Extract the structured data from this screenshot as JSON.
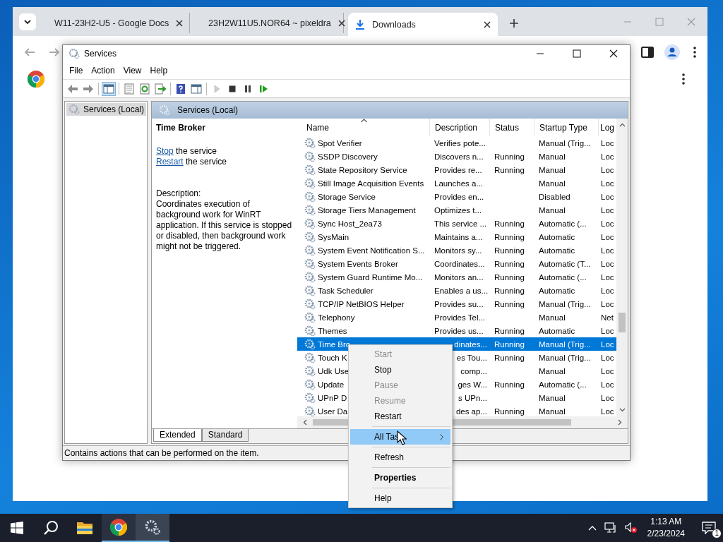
{
  "browser": {
    "tabs": [
      {
        "kind": "docs",
        "title": "W11-23H2-U5 - Google Docs",
        "selected": false
      },
      {
        "kind": "pixeldrain",
        "title": "23H2W11U5.NOR64 ~ pixeldra",
        "selected": false
      },
      {
        "kind": "download",
        "title": "Downloads",
        "selected": true
      }
    ]
  },
  "services_window": {
    "title": "Services",
    "menu": [
      "File",
      "Action",
      "View",
      "Help"
    ],
    "toolbar": [
      [
        {
          "kind": "back",
          "pressed": false,
          "disabled": false
        },
        {
          "kind": "forward",
          "pressed": false,
          "disabled": false
        }
      ],
      [
        {
          "kind": "tree",
          "pressed": true,
          "disabled": false
        }
      ],
      [
        {
          "kind": "sheet",
          "pressed": false,
          "disabled": false
        },
        {
          "kind": "refresh",
          "pressed": false,
          "disabled": false
        },
        {
          "kind": "export",
          "pressed": false,
          "disabled": false
        }
      ],
      [
        {
          "kind": "help",
          "pressed": false,
          "disabled": false
        },
        {
          "kind": "view",
          "pressed": false,
          "disabled": false
        }
      ],
      [
        {
          "kind": "play",
          "pressed": false,
          "disabled": true
        },
        {
          "kind": "stop",
          "pressed": false,
          "disabled": false
        },
        {
          "kind": "pause",
          "pressed": false,
          "disabled": false
        },
        {
          "kind": "restart",
          "pressed": false,
          "disabled": false
        }
      ]
    ],
    "tree": [
      {
        "label": "Services (Local)",
        "selected": true
      }
    ],
    "pane_title": "Services (Local)",
    "detail": {
      "name": "Time Broker",
      "actions": [
        {
          "link": "Stop",
          "text": "the service"
        },
        {
          "link": "Restart",
          "text": "the service"
        }
      ],
      "description_label": "Description:",
      "description": "Coordinates execution of background work for WinRT application. If this service is stopped or disabled, then background work might not be triggered."
    },
    "table": {
      "columns": [
        {
          "label": "Name",
          "sorted": true
        },
        {
          "label": "Description",
          "sorted": false
        },
        {
          "label": "Status",
          "sorted": false
        },
        {
          "label": "Startup Type",
          "sorted": false
        },
        {
          "label": "Log",
          "sorted": false
        }
      ],
      "rows": [
        {
          "name": "Spot Verifier",
          "description": "Verifies pote...",
          "startup": "Manual (Trig...",
          "log": "Loc",
          "selected": false,
          "covered": false
        },
        {
          "name": "SSDP Discovery",
          "description": "Discovers n...",
          "status": "Running",
          "startup": "Manual",
          "log": "Loc",
          "selected": false,
          "covered": false
        },
        {
          "name": "State Repository Service",
          "description": "Provides re...",
          "status": "Running",
          "startup": "Manual",
          "log": "Loc",
          "selected": false,
          "covered": false
        },
        {
          "name": "Still Image Acquisition Events",
          "description": "Launches a...",
          "startup": "Manual",
          "log": "Loc",
          "selected": false,
          "covered": false
        },
        {
          "name": "Storage Service",
          "description": "Provides en...",
          "startup": "Disabled",
          "log": "Loc",
          "selected": false,
          "covered": false
        },
        {
          "name": "Storage Tiers Management",
          "description": "Optimizes t...",
          "startup": "Manual",
          "log": "Loc",
          "selected": false,
          "covered": false
        },
        {
          "name": "Sync Host_2ea73",
          "description": "This service ...",
          "status": "Running",
          "startup": "Automatic (...",
          "log": "Loc",
          "selected": false,
          "covered": false
        },
        {
          "name": "SysMain",
          "description": "Maintains a...",
          "status": "Running",
          "startup": "Automatic",
          "log": "Loc",
          "selected": false,
          "covered": false
        },
        {
          "name": "System Event Notification S...",
          "description": "Monitors sy...",
          "status": "Running",
          "startup": "Automatic",
          "log": "Loc",
          "selected": false,
          "covered": false
        },
        {
          "name": "System Events Broker",
          "description": "Coordinates...",
          "status": "Running",
          "startup": "Automatic (T...",
          "log": "Loc",
          "selected": false,
          "covered": false
        },
        {
          "name": "System Guard Runtime Mo...",
          "description": "Monitors an...",
          "status": "Running",
          "startup": "Automatic (...",
          "log": "Loc",
          "selected": false,
          "covered": false
        },
        {
          "name": "Task Scheduler",
          "description": "Enables a us...",
          "status": "Running",
          "startup": "Automatic",
          "log": "Loc",
          "selected": false,
          "covered": false
        },
        {
          "name": "TCP/IP NetBIOS Helper",
          "description": "Provides su...",
          "status": "Running",
          "startup": "Manual (Trig...",
          "log": "Loc",
          "selected": false,
          "covered": false
        },
        {
          "name": "Telephony",
          "description": "Provides Tel...",
          "startup": "Manual",
          "log": "Net",
          "selected": false,
          "covered": false
        },
        {
          "name": "Themes",
          "description": "Provides us...",
          "status": "Running",
          "startup": "Automatic",
          "log": "Loc",
          "selected": false,
          "covered": false
        },
        {
          "name": "Time Bro",
          "description": "dinates...",
          "status": "Running",
          "startup": "Manual (Trig...",
          "log": "Loc",
          "selected": true,
          "covered": true
        },
        {
          "name": "Touch K",
          "description": "es Tou...",
          "status": "Running",
          "startup": "Manual (Trig...",
          "log": "Loc",
          "selected": false,
          "covered": true
        },
        {
          "name": "Udk Use",
          "description": "comp...",
          "startup": "Manual",
          "log": "Loc",
          "selected": false,
          "covered": true
        },
        {
          "name": "Update",
          "description": "ges W...",
          "status": "Running",
          "startup": "Automatic (...",
          "log": "Loc",
          "selected": false,
          "covered": true
        },
        {
          "name": "UPnP D",
          "description": "s UPn...",
          "startup": "Manual",
          "log": "Loc",
          "selected": false,
          "covered": true
        },
        {
          "name": "User Da",
          "description": "des ap...",
          "status": "Running",
          "startup": "Manual",
          "log": "Loc",
          "selected": false,
          "covered": true
        }
      ]
    },
    "view_tabs": [
      {
        "label": "Extended",
        "selected": true
      },
      {
        "label": "Standard",
        "selected": false
      }
    ],
    "status_bar": "Contains actions that can be performed on the item."
  },
  "context_menu": {
    "groups": [
      [
        {
          "label": "Start",
          "disabled": true,
          "selected": false,
          "default": false,
          "submenu": false
        },
        {
          "label": "Stop",
          "disabled": false,
          "selected": false,
          "default": false,
          "submenu": false
        },
        {
          "label": "Pause",
          "disabled": true,
          "selected": false,
          "default": false,
          "submenu": false
        },
        {
          "label": "Resume",
          "disabled": true,
          "selected": false,
          "default": false,
          "submenu": false
        },
        {
          "label": "Restart",
          "disabled": false,
          "selected": false,
          "default": false,
          "submenu": false
        }
      ],
      [
        {
          "label": "All Tas",
          "disabled": false,
          "selected": true,
          "default": false,
          "submenu": true
        }
      ],
      [
        {
          "label": "Refresh",
          "disabled": false,
          "selected": false,
          "default": false,
          "submenu": false
        }
      ],
      [
        {
          "label": "Properties",
          "disabled": false,
          "selected": false,
          "default": true,
          "submenu": false
        }
      ],
      [
        {
          "label": "Help",
          "disabled": false,
          "selected": false,
          "default": false,
          "submenu": false
        }
      ]
    ]
  },
  "taskbar": {
    "apps": [
      {
        "kind": "start",
        "open": false,
        "selected": false
      },
      {
        "kind": "search",
        "open": false,
        "selected": false
      },
      {
        "kind": "folder",
        "open": false,
        "selected": false
      },
      {
        "kind": "chrome",
        "open": true,
        "selected": false
      },
      {
        "kind": "services",
        "open": true,
        "selected": true
      }
    ],
    "time": "1:13 AM",
    "date": "2/23/2024",
    "notifications": "1"
  }
}
